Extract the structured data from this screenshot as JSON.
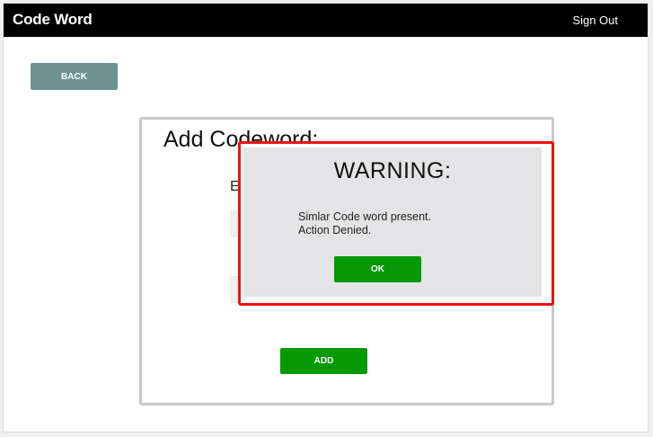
{
  "header": {
    "title": "Code Word",
    "sign_out_label": "Sign Out"
  },
  "toolbar": {
    "back_label": "BACK"
  },
  "form": {
    "title": "Add Codeword:",
    "field_label_partial": "E",
    "add_label": "ADD"
  },
  "dialog": {
    "title": "WARNING:",
    "message_line1": "Simlar Code word present.",
    "message_line2": "Action Denied.",
    "ok_label": "OK"
  },
  "colors": {
    "back_button": "#6f9393",
    "primary_button": "#059905",
    "highlight_border": "#ee1111",
    "dialog_background": "#e4e4e6"
  }
}
